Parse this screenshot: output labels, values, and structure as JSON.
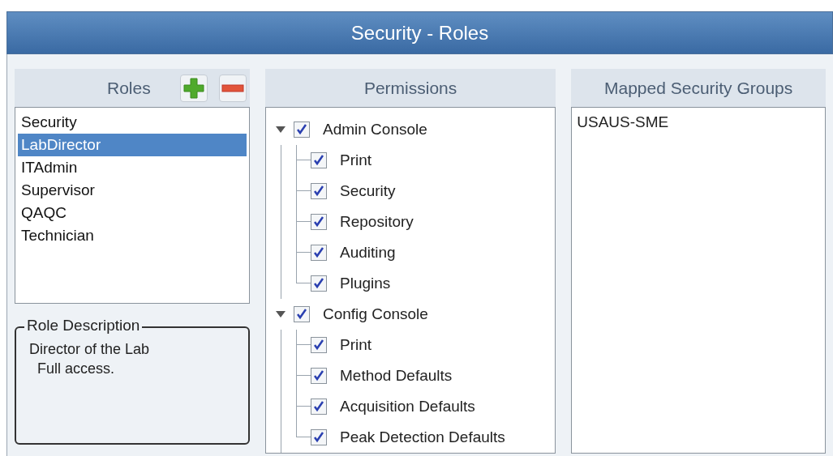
{
  "window": {
    "title": "Security - Roles"
  },
  "roles": {
    "header": "Roles",
    "items": [
      {
        "label": "Security",
        "selected": false
      },
      {
        "label": "LabDirector",
        "selected": true
      },
      {
        "label": "ITAdmin",
        "selected": false
      },
      {
        "label": "Supervisor",
        "selected": false
      },
      {
        "label": "QAQC",
        "selected": false
      },
      {
        "label": "Technician",
        "selected": false
      }
    ]
  },
  "role_description": {
    "legend": "Role Description",
    "lines": [
      "Director of the Lab",
      "Full access."
    ]
  },
  "permissions": {
    "header": "Permissions",
    "items": [
      {
        "label": "Admin Console",
        "checked": true,
        "expanded": true,
        "children": [
          {
            "label": "Print",
            "checked": true
          },
          {
            "label": "Security",
            "checked": true
          },
          {
            "label": "Repository",
            "checked": true
          },
          {
            "label": "Auditing",
            "checked": true
          },
          {
            "label": "Plugins",
            "checked": true
          }
        ]
      },
      {
        "label": "Config Console",
        "checked": true,
        "expanded": true,
        "children": [
          {
            "label": "Print",
            "checked": true
          },
          {
            "label": "Method Defaults",
            "checked": true
          },
          {
            "label": "Acquisition Defaults",
            "checked": true
          },
          {
            "label": "Peak Detection Defaults",
            "checked": true
          }
        ]
      }
    ]
  },
  "mapped_security_groups": {
    "header": "Mapped Security Groups",
    "items": [
      "USAUS-SME"
    ]
  }
}
